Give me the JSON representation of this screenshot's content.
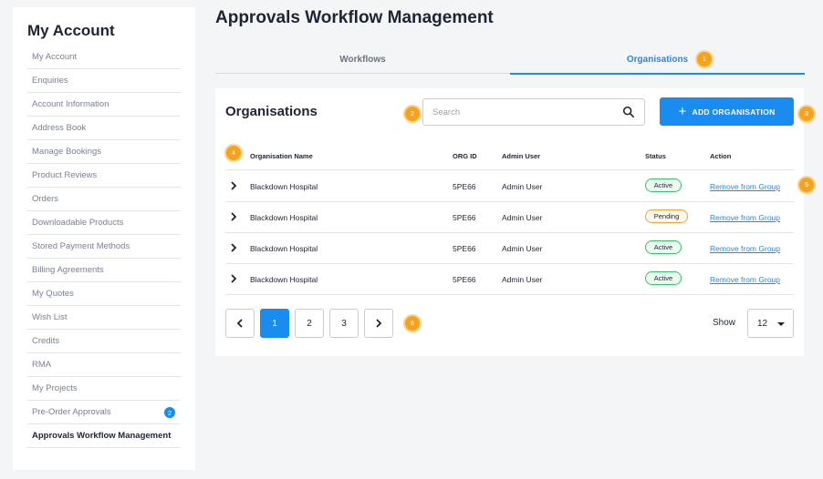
{
  "sidebar": {
    "title": "My Account",
    "items": [
      {
        "label": "My Account"
      },
      {
        "label": "Enquiries"
      },
      {
        "label": "Account Information"
      },
      {
        "label": "Address Book"
      },
      {
        "label": "Manage Bookings"
      },
      {
        "label": "Product Reviews"
      },
      {
        "label": "Orders"
      },
      {
        "label": "Downloadable Products"
      },
      {
        "label": "Stored Payment Methods"
      },
      {
        "label": "Billing Agreements"
      },
      {
        "label": "My Quotes"
      },
      {
        "label": "Wish List"
      },
      {
        "label": "Credits"
      },
      {
        "label": "RMA"
      },
      {
        "label": "My Projects"
      },
      {
        "label": "Pre-Order Approvals",
        "badge": "2"
      },
      {
        "label": "Approvals Workflow Management",
        "active": true
      }
    ]
  },
  "page": {
    "title": "Approvals Workflow Management"
  },
  "tabs": [
    {
      "label": "Workflows",
      "active": false
    },
    {
      "label": "Organisations",
      "active": true
    }
  ],
  "markers": [
    "1",
    "2",
    "3",
    "4",
    "5",
    "6"
  ],
  "card": {
    "title": "Organisations",
    "search": {
      "placeholder": "Search"
    },
    "add_button": {
      "label": "ADD ORGANISATION"
    }
  },
  "table": {
    "columns": [
      "Organisation Name",
      "ORG ID",
      "Admin User",
      "Status",
      "Action"
    ],
    "rows": [
      {
        "name": "Blackdown Hospital",
        "org_id": "5PE66",
        "admin": "Admin User",
        "status": "Active",
        "action": "Remove from Group"
      },
      {
        "name": "Blackdown Hospital",
        "org_id": "5PE66",
        "admin": "Admin User",
        "status": "Pending",
        "action": "Remove from Group"
      },
      {
        "name": "Blackdown Hospital",
        "org_id": "5PE66",
        "admin": "Admin User",
        "status": "Active",
        "action": "Remove from Group"
      },
      {
        "name": "Blackdown Hospital",
        "org_id": "5PE66",
        "admin": "Admin User",
        "status": "Active",
        "action": "Remove from Group"
      }
    ]
  },
  "pagination": {
    "pages": [
      "1",
      "2",
      "3"
    ],
    "current": "1",
    "show_label": "Show",
    "page_size": "12"
  },
  "colors": {
    "accent": "#1a8cf0",
    "marker": "#f6a21a",
    "active_status": "#3cbf6a",
    "pending_status": "#f0a23a"
  },
  "icons": {
    "search": "search-icon",
    "add": "plus-icon",
    "expand": "chevron-right-icon",
    "prev": "chevron-left-icon",
    "next": "chevron-right-icon",
    "dropdown": "caret-down-icon"
  }
}
